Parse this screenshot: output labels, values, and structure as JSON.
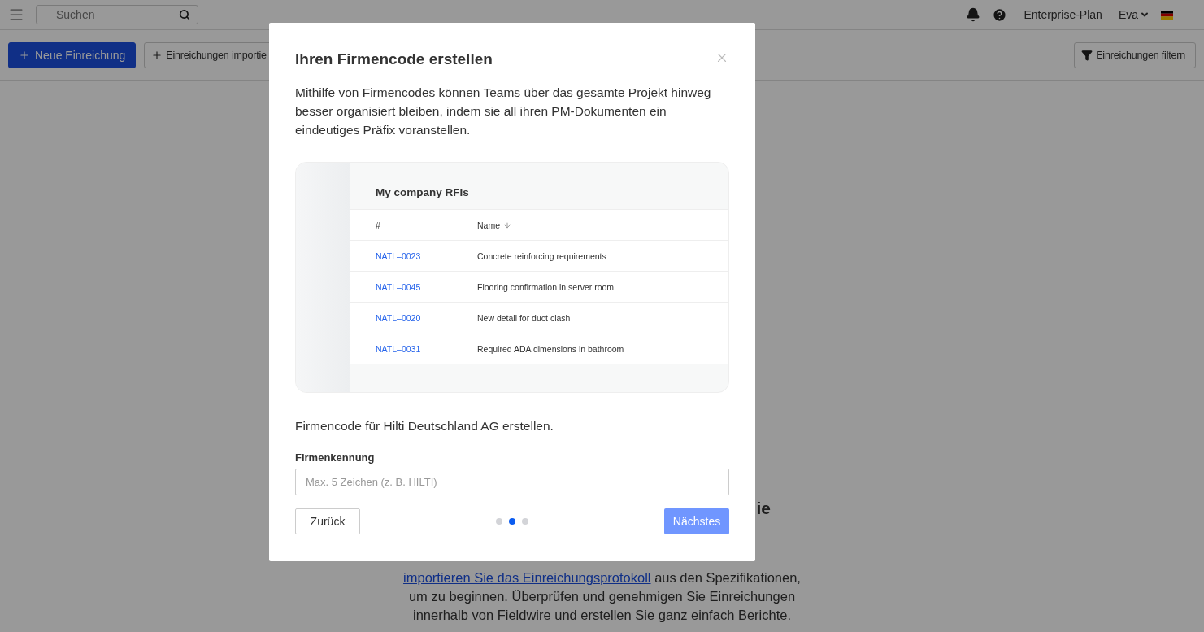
{
  "top_bar": {
    "search": {
      "placeholder": "Suchen"
    },
    "plan": "Enterprise-Plan",
    "user": "Eva"
  },
  "toolbar": {
    "buttons": [
      {
        "label": "Neue Einreichung",
        "kind": "primary"
      },
      {
        "label": "Einreichungen importie",
        "kind": "secondary"
      }
    ],
    "filter_button": "Einreichungen filtern"
  },
  "empty_state": {
    "heading": "ie",
    "link": "importieren Sie das Einreichungsprotokoll",
    "text": " aus den Spezifikationen, um zu beginnen. Überprüfen und genehmigen Sie Einreichungen innerhalb von Fieldwire und erstellen Sie ganz einfach Berichte."
  },
  "dialog": {
    "title": "Ihren Firmencode erstellen",
    "description": "Mithilfe von Firmencodes können Teams über das gesamte Projekt hinweg besser organisiert bleiben, indem sie all ihren PM-Dokumenten ein eindeutiges Präfix voranstellen.",
    "preview": {
      "title": "My company RFIs",
      "columns": [
        "#",
        "Name"
      ],
      "rows": [
        {
          "code": "NATL–0023",
          "name": "Concrete reinforcing requirements"
        },
        {
          "code": "NATL–0045",
          "name": "Flooring confirmation in server room"
        },
        {
          "code": "NATL–0020",
          "name": "New detail for duct clash"
        },
        {
          "code": "NATL–0031",
          "name": "Required ADA dimensions in bathroom"
        }
      ]
    },
    "company_text": "Firmencode für Hilti Deutschland AG erstellen.",
    "field": {
      "label": "Firmenkennung",
      "placeholder": "Max. 5 Zeichen (z. B. HILTI)"
    },
    "back_button": "Zurück",
    "steps": [
      {
        "selected": false
      },
      {
        "selected": true
      },
      {
        "selected": false
      }
    ],
    "next_button": {
      "label": "Nächstes",
      "disabled": true
    }
  }
}
